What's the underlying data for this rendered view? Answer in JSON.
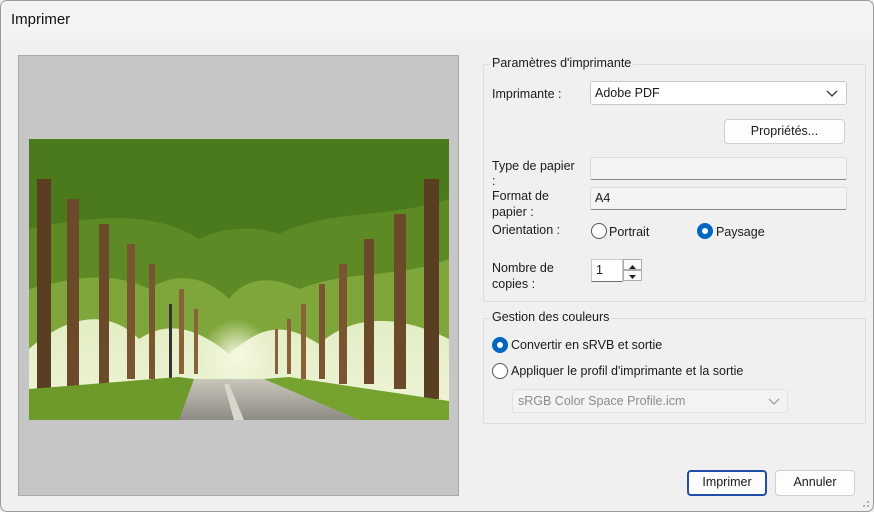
{
  "window": {
    "title": "Imprimer"
  },
  "printer_settings": {
    "group_label": "Paramètres d'imprimante",
    "printer_label": "Imprimante :",
    "printer_value": "Adobe PDF",
    "properties_button": "Propriétés...",
    "paper_type_label_1": "Type de papier",
    "paper_type_label_2": ":",
    "paper_type_value": "",
    "paper_format_label_1": "Format de",
    "paper_format_label_2": "papier :",
    "paper_format_value": "A4",
    "orientation_label": "Orientation :",
    "portrait_label": "Portrait",
    "landscape_label": "Paysage",
    "orientation_selected": "Paysage",
    "copies_label_1": "Nombre de",
    "copies_label_2": "copies :",
    "copies_value": "1"
  },
  "color_management": {
    "group_label": "Gestion des couleurs",
    "option_srgb": "Convertir en sRVB et sortie",
    "option_profile": "Appliquer le profil d'imprimante et la sortie",
    "selected": "Convertir en sRVB et sortie",
    "profile_value": "sRGB Color Space Profile.icm"
  },
  "buttons": {
    "print": "Imprimer",
    "cancel": "Annuler"
  },
  "colors": {
    "accent": "#0067c0",
    "preview_bg": "#c6c6c6",
    "dialog_bg": "#f0f0f0"
  }
}
